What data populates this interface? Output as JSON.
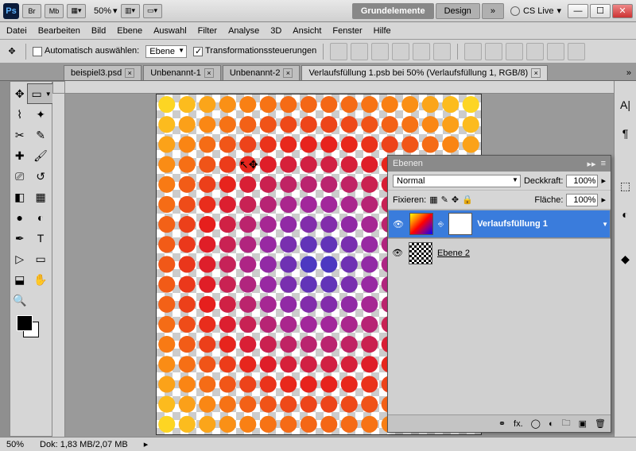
{
  "titlebar": {
    "br": "Br",
    "mb": "Mb",
    "zoom": "50%",
    "workspace_active": "Grundelemente",
    "workspace_design": "Design",
    "more": "»",
    "cslive": "CS Live"
  },
  "menu": [
    "Datei",
    "Bearbeiten",
    "Bild",
    "Ebene",
    "Auswahl",
    "Filter",
    "Analyse",
    "3D",
    "Ansicht",
    "Fenster",
    "Hilfe"
  ],
  "options": {
    "auto_select": "Automatisch auswählen:",
    "target": "Ebene",
    "transform_controls": "Transformationssteuerungen"
  },
  "tabs": [
    {
      "label": "beispiel3.psd",
      "active": false
    },
    {
      "label": "Unbenannt-1",
      "active": false
    },
    {
      "label": "Unbenannt-2",
      "active": false
    },
    {
      "label": "Verlaufsfüllung 1.psb bei 50% (Verlaufsfüllung 1, RGB/8)",
      "active": true
    }
  ],
  "tabs_more": "»",
  "panel": {
    "title": "Ebenen",
    "blend_mode": "Normal",
    "opacity_label": "Deckkraft:",
    "opacity": "100%",
    "lock_label": "Fixieren:",
    "fill_label": "Fläche:",
    "fill": "100%",
    "layers": [
      {
        "name": "Verlaufsfüllung 1",
        "selected": true,
        "type": "gradient"
      },
      {
        "name": "Ebene 2",
        "selected": false,
        "type": "pattern"
      }
    ]
  },
  "status": {
    "zoom": "50%",
    "dok": "Dok: 1,83 MB/2,07 MB"
  }
}
